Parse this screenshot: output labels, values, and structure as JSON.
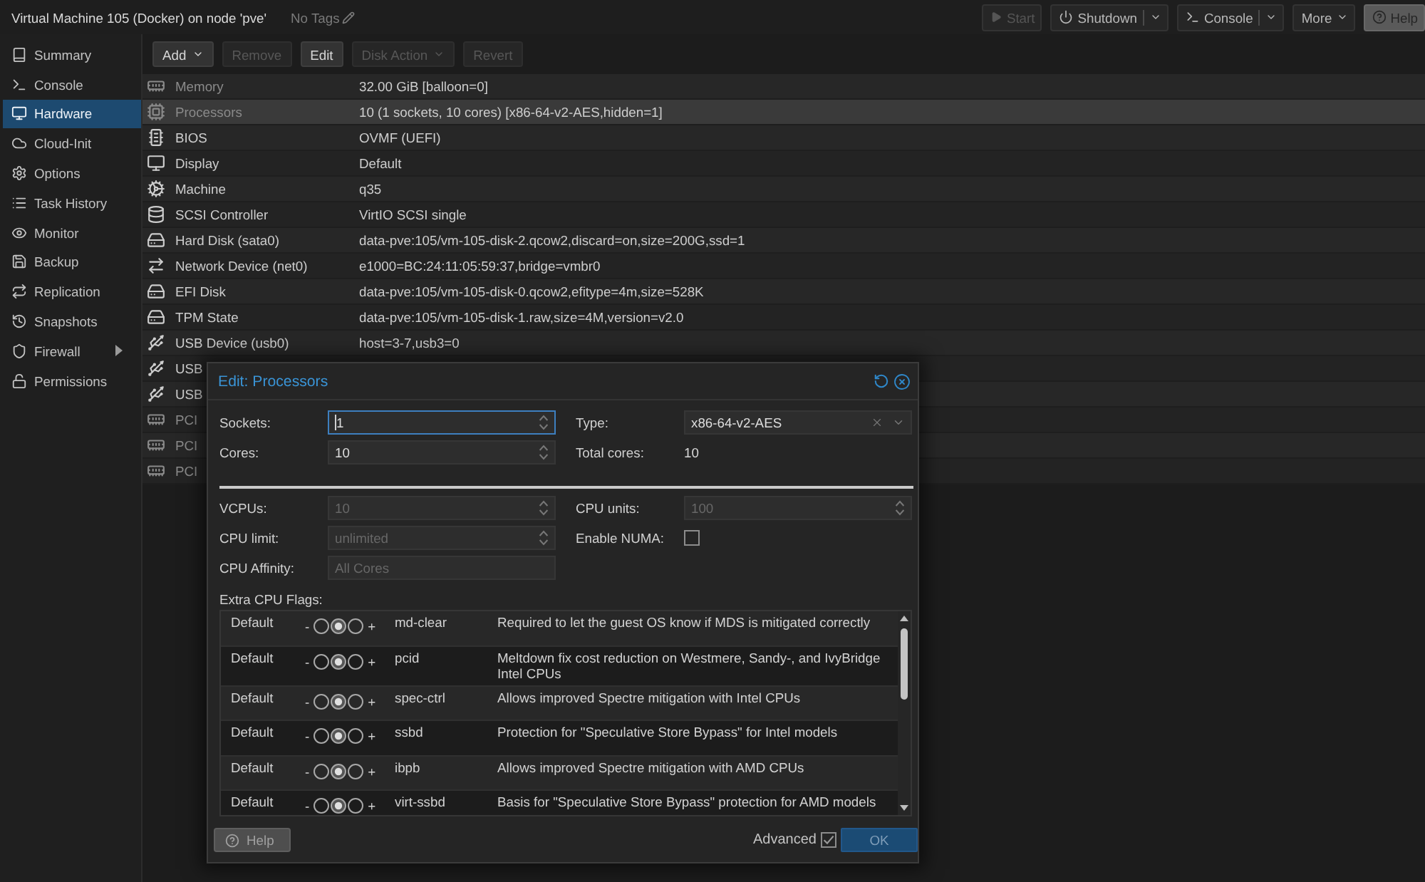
{
  "window": {
    "title": "Virtual Machine 105 (Docker) on node 'pve'",
    "tags": "No Tags"
  },
  "top_buttons": [
    {
      "kind": "start",
      "label": "Start",
      "disabled": true,
      "dropdown": false,
      "split": false
    },
    {
      "kind": "shutdown",
      "label": "Shutdown",
      "disabled": false,
      "dropdown": true,
      "split": true
    },
    {
      "kind": "console",
      "label": "Console",
      "disabled": false,
      "dropdown": true,
      "split": true
    },
    {
      "kind": "more",
      "label": "More",
      "disabled": false,
      "dropdown": true,
      "split": false
    },
    {
      "kind": "help",
      "label": "Help",
      "disabled": false,
      "dropdown": false,
      "split": false
    }
  ],
  "sidebar": {
    "items": [
      {
        "kind": "summary",
        "label": "Summary",
        "selected": false,
        "submenu": false
      },
      {
        "kind": "console",
        "label": "Console",
        "selected": false,
        "submenu": false
      },
      {
        "kind": "hardware",
        "label": "Hardware",
        "selected": true,
        "submenu": false
      },
      {
        "kind": "cloud-init",
        "label": "Cloud-Init",
        "selected": false,
        "submenu": false
      },
      {
        "kind": "options",
        "label": "Options",
        "selected": false,
        "submenu": false
      },
      {
        "kind": "task-history",
        "label": "Task History",
        "selected": false,
        "submenu": false
      },
      {
        "kind": "monitor",
        "label": "Monitor",
        "selected": false,
        "submenu": false
      },
      {
        "kind": "backup",
        "label": "Backup",
        "selected": false,
        "submenu": false
      },
      {
        "kind": "replication",
        "label": "Replication",
        "selected": false,
        "submenu": false
      },
      {
        "kind": "snapshots",
        "label": "Snapshots",
        "selected": false,
        "submenu": false
      },
      {
        "kind": "firewall",
        "label": "Firewall",
        "selected": false,
        "submenu": true
      },
      {
        "kind": "permissions",
        "label": "Permissions",
        "selected": false,
        "submenu": false
      }
    ]
  },
  "toolbar": {
    "buttons": [
      {
        "label": "Add",
        "disabled": false,
        "menu": true
      },
      {
        "label": "Remove",
        "disabled": true,
        "menu": false
      },
      {
        "label": "Edit",
        "disabled": false,
        "menu": false
      },
      {
        "label": "Disk Action",
        "disabled": true,
        "menu": true
      },
      {
        "label": "Revert",
        "disabled": true,
        "menu": false
      }
    ]
  },
  "hardware": {
    "rows": [
      {
        "kind": "memory",
        "name": "Memory",
        "value": "32.00 GiB [balloon=0]",
        "selected": false,
        "dimmed": true
      },
      {
        "kind": "processor",
        "name": "Processors",
        "value": "10 (1 sockets, 10 cores) [x86-64-v2-AES,hidden=1]",
        "selected": true,
        "dimmed": true
      },
      {
        "kind": "bios",
        "name": "BIOS",
        "value": "OVMF (UEFI)",
        "selected": false,
        "dimmed": false
      },
      {
        "kind": "display",
        "name": "Display",
        "value": "Default",
        "selected": false,
        "dimmed": false
      },
      {
        "kind": "machine",
        "name": "Machine",
        "value": "q35",
        "selected": false,
        "dimmed": false
      },
      {
        "kind": "scsi",
        "name": "SCSI Controller",
        "value": "VirtIO SCSI single",
        "selected": false,
        "dimmed": false
      },
      {
        "kind": "disk",
        "name": "Hard Disk (sata0)",
        "value": "data-pve:105/vm-105-disk-2.qcow2,discard=on,size=200G,ssd=1",
        "selected": false,
        "dimmed": false
      },
      {
        "kind": "network",
        "name": "Network Device (net0)",
        "value": "e1000=BC:24:11:05:59:37,bridge=vmbr0",
        "selected": false,
        "dimmed": false
      },
      {
        "kind": "disk",
        "name": "EFI Disk",
        "value": "data-pve:105/vm-105-disk-0.qcow2,efitype=4m,size=528K",
        "selected": false,
        "dimmed": false
      },
      {
        "kind": "disk",
        "name": "TPM State",
        "value": "data-pve:105/vm-105-disk-1.raw,size=4M,version=v2.0",
        "selected": false,
        "dimmed": false
      },
      {
        "kind": "usb",
        "name": "USB Device (usb0)",
        "value": "host=3-7,usb3=0",
        "selected": false,
        "dimmed": false
      },
      {
        "kind": "usb",
        "name": "USB",
        "selected": false,
        "dimmed": false
      },
      {
        "kind": "usb",
        "name": "USB",
        "selected": false,
        "dimmed": false
      },
      {
        "kind": "pci",
        "name": "PCI",
        "selected": false,
        "dimmed": true
      },
      {
        "kind": "pci",
        "name": "PCI",
        "selected": false,
        "dimmed": true
      },
      {
        "kind": "pci",
        "name": "PCI",
        "selected": false,
        "dimmed": true
      }
    ]
  },
  "dialog": {
    "title": "Edit: Processors",
    "basic_rows": [
      {
        "left": {
          "label": "Sockets:",
          "kind": "spinner",
          "value": "1",
          "focused": true
        },
        "right": {
          "label": "Type:",
          "kind": "combo",
          "value": "x86-64-v2-AES",
          "focused": false
        }
      },
      {
        "left": {
          "label": "Cores:",
          "kind": "spinner",
          "value": "10",
          "focused": false
        },
        "right": {
          "label": "Total cores:",
          "kind": "display",
          "value": "10"
        }
      }
    ],
    "advanced_rows": [
      {
        "left": {
          "label": "VCPUs:",
          "kind": "spinner",
          "placeholder": "10",
          "focused": false
        },
        "right": {
          "label": "CPU units:",
          "kind": "spinner",
          "placeholder": "100",
          "focused": false
        }
      },
      {
        "left": {
          "label": "CPU limit:",
          "kind": "spinner",
          "placeholder": "unlimited",
          "focused": false
        },
        "right": {
          "label": "Enable NUMA:",
          "kind": "checkbox",
          "checked": false
        }
      },
      {
        "left": {
          "label": "CPU Affinity:",
          "kind": "text",
          "placeholder": "All Cores",
          "focused": false
        }
      }
    ],
    "flags_label": "Extra CPU Flags:",
    "cpu_flags": [
      {
        "state_label": "Default",
        "minus": "-",
        "plus": "+",
        "options": [
          {
            "selected": false
          },
          {
            "selected": true
          },
          {
            "selected": false
          }
        ],
        "flag": "md-clear",
        "description": "Required to let the guest OS know if MDS is mitigated correctly"
      },
      {
        "state_label": "Default",
        "minus": "-",
        "plus": "+",
        "options": [
          {
            "selected": false
          },
          {
            "selected": true
          },
          {
            "selected": false
          }
        ],
        "flag": "pcid",
        "description": "Meltdown fix cost reduction on Westmere, Sandy-, and IvyBridge Intel CPUs"
      },
      {
        "state_label": "Default",
        "minus": "-",
        "plus": "+",
        "options": [
          {
            "selected": false
          },
          {
            "selected": true
          },
          {
            "selected": false
          }
        ],
        "flag": "spec-ctrl",
        "description": "Allows improved Spectre mitigation with Intel CPUs"
      },
      {
        "state_label": "Default",
        "minus": "-",
        "plus": "+",
        "options": [
          {
            "selected": false
          },
          {
            "selected": true
          },
          {
            "selected": false
          }
        ],
        "flag": "ssbd",
        "description": "Protection for \"Speculative Store Bypass\" for Intel models"
      },
      {
        "state_label": "Default",
        "minus": "-",
        "plus": "+",
        "options": [
          {
            "selected": false
          },
          {
            "selected": true
          },
          {
            "selected": false
          }
        ],
        "flag": "ibpb",
        "description": "Allows improved Spectre mitigation with AMD CPUs"
      },
      {
        "state_label": "Default",
        "minus": "-",
        "plus": "+",
        "options": [
          {
            "selected": false
          },
          {
            "selected": true
          },
          {
            "selected": false
          }
        ],
        "flag": "virt-ssbd",
        "description": "Basis for \"Speculative Store Bypass\" protection for AMD models"
      }
    ],
    "footer": {
      "help": "Help",
      "advanced": {
        "label": "Advanced",
        "checked": true
      },
      "ok": {
        "label": "OK",
        "disabled": true
      }
    }
  }
}
